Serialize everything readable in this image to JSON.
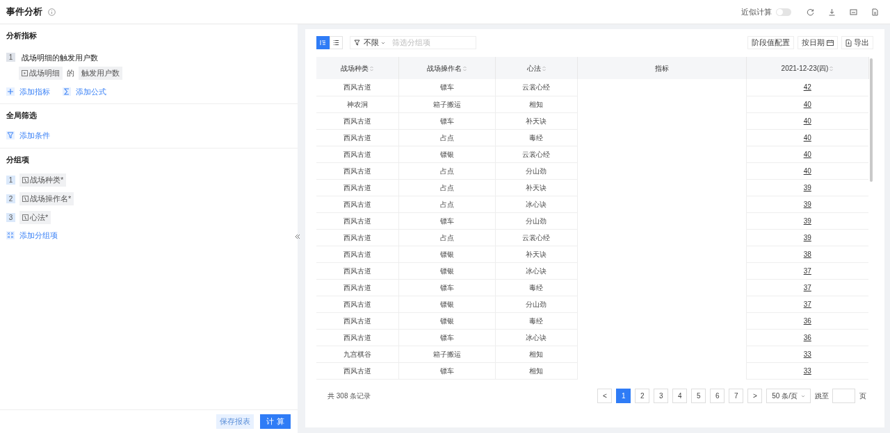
{
  "header": {
    "title": "事件分析",
    "approx_label": "近似计算",
    "approx_on": false
  },
  "metrics_section": {
    "title": "分析指标",
    "items": [
      {
        "index": "1",
        "name": "战场明细的触发用户数",
        "event": "战场明细",
        "joiner": "的",
        "measure": "触发用户数"
      }
    ],
    "actions": [
      {
        "kind": "plus",
        "label": "添加指标"
      },
      {
        "kind": "sigma",
        "label": "添加公式"
      }
    ]
  },
  "filter_section": {
    "title": "全局筛选",
    "action": {
      "kind": "funnel",
      "label": "添加条件"
    }
  },
  "group_section": {
    "title": "分组项",
    "items": [
      {
        "index": "1",
        "label": "战场种类*"
      },
      {
        "index": "2",
        "label": "战场操作名*"
      },
      {
        "index": "3",
        "label": "心法*"
      }
    ],
    "action": {
      "kind": "group",
      "label": "添加分组项"
    }
  },
  "footer_buttons": [
    {
      "label": "保存报表",
      "primary": false
    },
    {
      "label": "计 算",
      "primary": true
    }
  ],
  "toolbar": {
    "views": [
      {
        "kind": "tree",
        "selected": true
      },
      {
        "kind": "list",
        "selected": false
      }
    ],
    "filter_value": "不限",
    "filter_placeholder": "筛选分组项",
    "right_buttons": [
      {
        "kind": "plain",
        "label": "阶段值配置"
      },
      {
        "kind": "calendar",
        "label": "按日期"
      },
      {
        "kind": "export",
        "label": "导出"
      }
    ]
  },
  "table": {
    "columns": [
      {
        "label": "战场种类",
        "sortable": true
      },
      {
        "label": "战场操作名",
        "sortable": true
      },
      {
        "label": "心法",
        "sortable": true
      },
      {
        "label": "指标",
        "sortable": false
      },
      {
        "label": "2021-12-23(四)",
        "sortable": true
      }
    ],
    "rows": [
      [
        "西风古道",
        "镖车",
        "云裳心经",
        "42"
      ],
      [
        "神农涧",
        "箱子搬运",
        "相知",
        "40"
      ],
      [
        "西风古道",
        "镖车",
        "补天诀",
        "40"
      ],
      [
        "西风古道",
        "占点",
        "毒经",
        "40"
      ],
      [
        "西风古道",
        "镖银",
        "云裳心经",
        "40"
      ],
      [
        "西风古道",
        "占点",
        "分山劲",
        "40"
      ],
      [
        "西风古道",
        "占点",
        "补天诀",
        "39"
      ],
      [
        "西风古道",
        "占点",
        "冰心诀",
        "39"
      ],
      [
        "西风古道",
        "镖车",
        "分山劲",
        "39"
      ],
      [
        "西风古道",
        "占点",
        "云裳心经",
        "39"
      ],
      [
        "西风古道",
        "镖银",
        "补天诀",
        "38"
      ],
      [
        "西风古道",
        "镖银",
        "冰心诀",
        "37"
      ],
      [
        "西风古道",
        "镖车",
        "毒经",
        "37"
      ],
      [
        "西风古道",
        "镖银",
        "分山劲",
        "37"
      ],
      [
        "西风古道",
        "镖银",
        "毒经",
        "36"
      ],
      [
        "西风古道",
        "镖车",
        "冰心诀",
        "36"
      ],
      [
        "九宫棋谷",
        "箱子搬运",
        "相知",
        "33"
      ],
      [
        "西风古道",
        "镖车",
        "相知",
        "33"
      ]
    ]
  },
  "pagination": {
    "total": "共 308 条记录",
    "prev": "<",
    "next": ">",
    "pages": [
      {
        "label": "1",
        "selected": true
      },
      {
        "label": "2",
        "selected": false
      },
      {
        "label": "3",
        "selected": false
      },
      {
        "label": "4",
        "selected": false
      },
      {
        "label": "5",
        "selected": false
      },
      {
        "label": "6",
        "selected": false
      },
      {
        "label": "7",
        "selected": false
      }
    ],
    "page_size": "50 条/页",
    "jump_label": "跳至",
    "jump_suffix": "页"
  }
}
